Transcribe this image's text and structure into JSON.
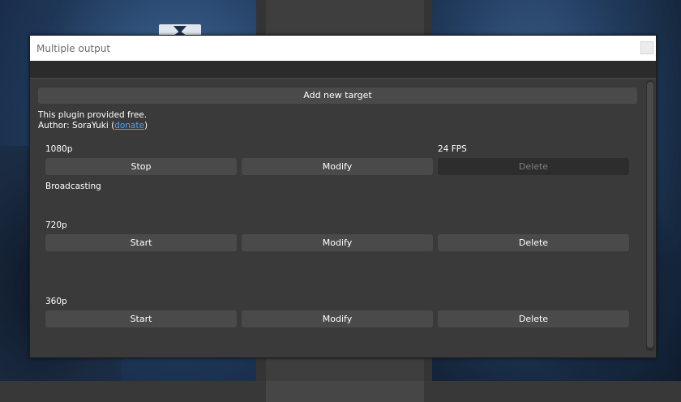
{
  "window": {
    "title": "Multiple output"
  },
  "plugin": {
    "add_target_label": "Add new target",
    "free_text": "This plugin provided free.",
    "author_prefix": "Author: SoraYuki (",
    "donate_label": "donate",
    "author_suffix": ")"
  },
  "targets": [
    {
      "name": "1080p",
      "fps": "24 FPS",
      "status": "Broadcasting",
      "start_stop_label": "Stop",
      "modify_label": "Modify",
      "delete_label": "Delete",
      "delete_disabled": true
    },
    {
      "name": "720p",
      "fps": "",
      "status": "",
      "start_stop_label": "Start",
      "modify_label": "Modify",
      "delete_label": "Delete",
      "delete_disabled": false
    },
    {
      "name": "360p",
      "fps": "",
      "status": "",
      "start_stop_label": "Start",
      "modify_label": "Modify",
      "delete_label": "Delete",
      "delete_disabled": false
    }
  ],
  "colors": {
    "dialog_bg": "#3a3a3a",
    "button_bg": "#4a4a4a",
    "link": "#4aa3ff"
  }
}
